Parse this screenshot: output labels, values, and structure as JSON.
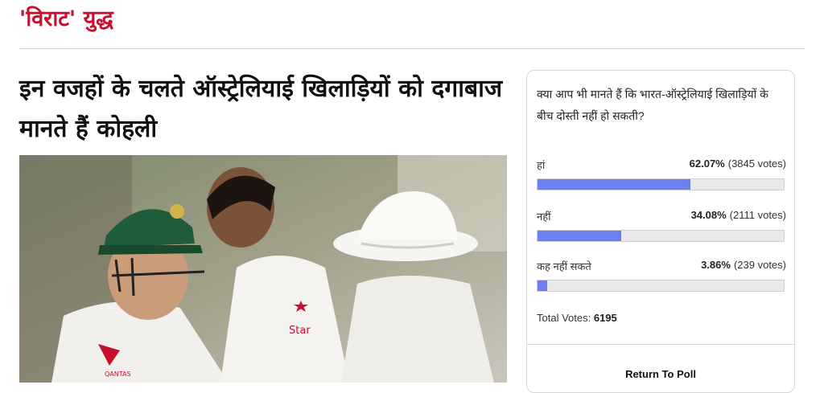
{
  "section": {
    "title": "'विराट' युद्ध"
  },
  "article": {
    "headline": "इन वजहों के चलते ऑस्ट्रेलियाई खिलाड़ियों को दगाबाज मानते हैं कोहली",
    "image": {
      "sponsor_logo_text": "QANTAS",
      "shirt_logo_text": "Star"
    }
  },
  "poll": {
    "question": "क्या आप भी मानते हैं कि भारत-ऑस्ट्रेलियाई खिलाड़ियों के बीच दोस्ती नहीं हो सकती?",
    "options": [
      {
        "label": "हां",
        "percent": "62.07%",
        "votes": "(3845 votes)",
        "fraction": 0.6207
      },
      {
        "label": "नहीं",
        "percent": "34.08%",
        "votes": "(2111 votes)",
        "fraction": 0.3408
      },
      {
        "label": "कह नहीं सकते",
        "percent": "3.86%",
        "votes": "(239 votes)",
        "fraction": 0.0386
      }
    ],
    "total_label": "Total Votes:",
    "total_value": "6195",
    "return_label": "Return To Poll",
    "bar_color": "#6b7ff0"
  },
  "colors": {
    "accent": "#c8102e"
  }
}
